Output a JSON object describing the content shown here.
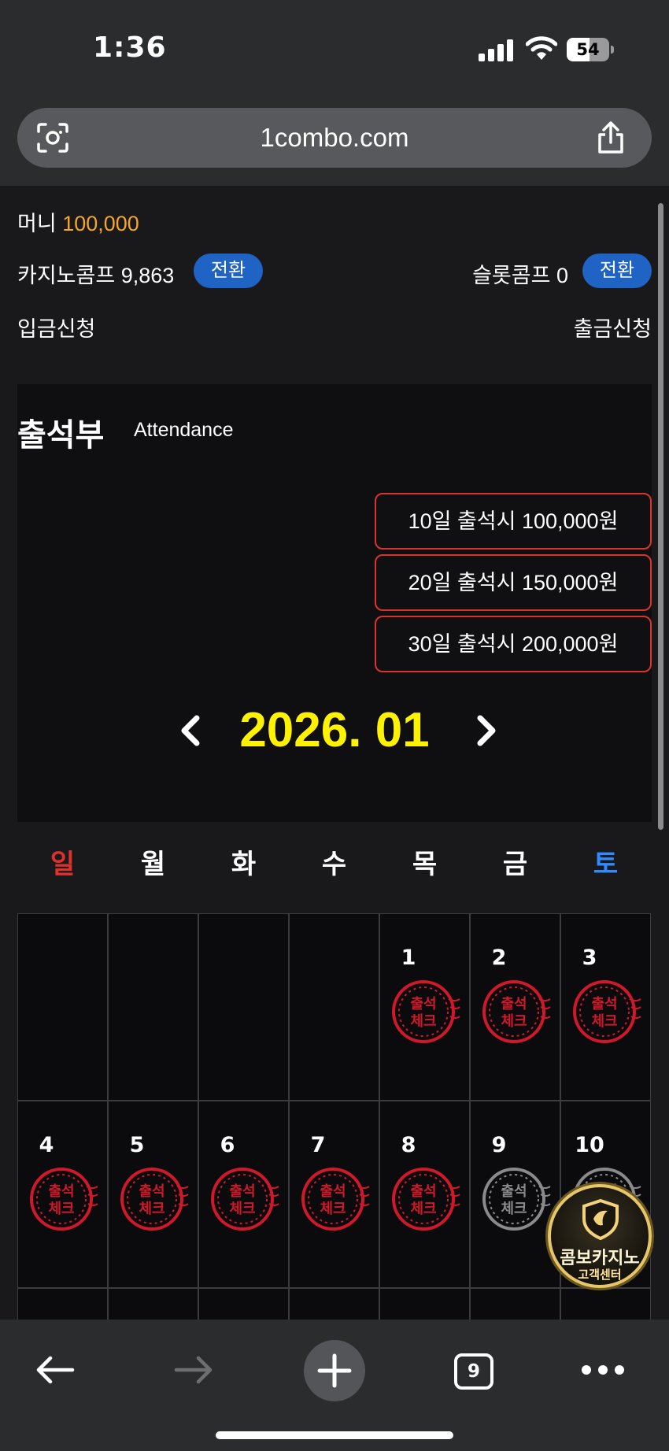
{
  "status_bar": {
    "time": "1:36",
    "battery": "54"
  },
  "browser": {
    "url": "1combo.com",
    "tab_count": "9"
  },
  "account": {
    "money_label": "머니",
    "money_value": "100,000",
    "casino_comp_label": "카지노콤프",
    "casino_comp_value": "9,863",
    "slot_comp_label": "슬롯콤프",
    "slot_comp_value": "0",
    "convert_label": "전환",
    "deposit_label": "입금신청",
    "withdraw_label": "출금신청"
  },
  "attendance": {
    "title": "출석부",
    "subtitle": "Attendance",
    "rewards": [
      "10일 출석시 100,000원",
      "20일 출석시 150,000원",
      "30일 출석시 200,000원"
    ],
    "month": "2026. 01"
  },
  "weekdays": [
    "일",
    "월",
    "화",
    "수",
    "목",
    "금",
    "토"
  ],
  "calendar": {
    "stamp_text_top": "출석",
    "stamp_text_bottom": "체크",
    "week1": [
      {
        "day": "",
        "stamp": ""
      },
      {
        "day": "",
        "stamp": ""
      },
      {
        "day": "",
        "stamp": ""
      },
      {
        "day": "",
        "stamp": ""
      },
      {
        "day": "1",
        "stamp": "checked"
      },
      {
        "day": "2",
        "stamp": "checked"
      },
      {
        "day": "3",
        "stamp": "checked"
      }
    ],
    "week2": [
      {
        "day": "4",
        "stamp": "checked"
      },
      {
        "day": "5",
        "stamp": "checked"
      },
      {
        "day": "6",
        "stamp": "checked"
      },
      {
        "day": "7",
        "stamp": "checked"
      },
      {
        "day": "8",
        "stamp": "checked"
      },
      {
        "day": "9",
        "stamp": "unchecked"
      },
      {
        "day": "10",
        "stamp": "unchecked"
      }
    ]
  },
  "customer_center": {
    "name": "콤보카지노",
    "sub": "고객센터"
  },
  "colors": {
    "accent_blue": "#1f63c4",
    "money_orange": "#f5a623",
    "month_yellow": "#fff200",
    "sunday_red": "#e0302a",
    "saturday_blue": "#2f8cff",
    "stamp_red": "#d0182a",
    "stamp_gray": "#8a8a8c"
  },
  "icons": [
    "camera-search-icon",
    "share-icon",
    "chevron-left-icon",
    "chevron-right-icon",
    "back-arrow-icon",
    "forward-arrow-icon",
    "plus-icon",
    "tabs-icon",
    "more-icon",
    "signal-icon",
    "wifi-icon",
    "battery-icon",
    "shield-logo-icon"
  ]
}
